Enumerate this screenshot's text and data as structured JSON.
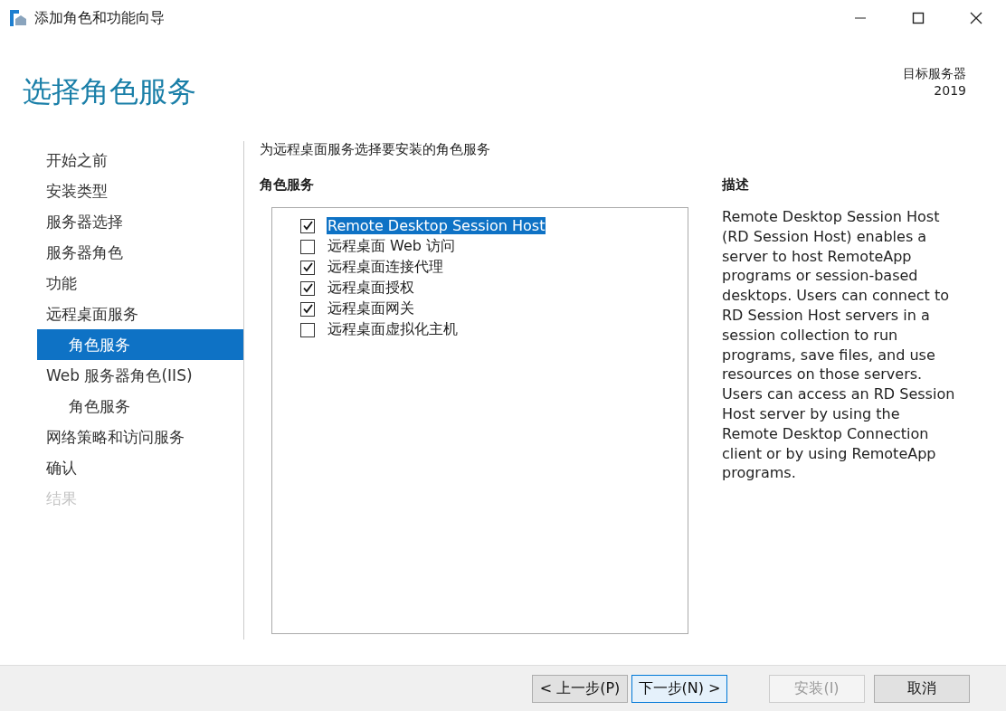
{
  "window": {
    "title": "添加角色和功能向导"
  },
  "header": {
    "title": "选择角色服务",
    "target_label": "目标服务器",
    "target_value": "2019"
  },
  "sidebar": {
    "items": [
      {
        "label": "开始之前",
        "selected": false,
        "disabled": false
      },
      {
        "label": "安装类型",
        "selected": false,
        "disabled": false
      },
      {
        "label": "服务器选择",
        "selected": false,
        "disabled": false
      },
      {
        "label": "服务器角色",
        "selected": false,
        "disabled": false
      },
      {
        "label": "功能",
        "selected": false,
        "disabled": false
      },
      {
        "label": "远程桌面服务",
        "selected": false,
        "disabled": false,
        "children": [
          {
            "label": "角色服务",
            "selected": true,
            "disabled": false
          }
        ]
      },
      {
        "label": "Web 服务器角色(IIS)",
        "selected": false,
        "disabled": false,
        "children": [
          {
            "label": "角色服务",
            "selected": false,
            "disabled": false
          }
        ]
      },
      {
        "label": "网络策略和访问服务",
        "selected": false,
        "disabled": false
      },
      {
        "label": "确认",
        "selected": false,
        "disabled": false
      },
      {
        "label": "结果",
        "selected": false,
        "disabled": true
      }
    ]
  },
  "instruction": "为远程桌面服务选择要安装的角色服务",
  "role_services": {
    "heading": "角色服务",
    "items": [
      {
        "label": "Remote Desktop Session Host",
        "checked": true,
        "selected": true
      },
      {
        "label": "远程桌面 Web 访问",
        "checked": false,
        "selected": false
      },
      {
        "label": "远程桌面连接代理",
        "checked": true,
        "selected": false
      },
      {
        "label": "远程桌面授权",
        "checked": true,
        "selected": false
      },
      {
        "label": "远程桌面网关",
        "checked": true,
        "selected": false
      },
      {
        "label": "远程桌面虚拟化主机",
        "checked": false,
        "selected": false
      }
    ]
  },
  "description": {
    "heading": "描述",
    "text": "Remote Desktop Session Host (RD Session Host) enables a server to host RemoteApp programs or session-based desktops. Users can connect to RD Session Host servers in a session collection to run programs, save files, and use resources on those servers. Users can access an RD Session Host server by using the Remote Desktop Connection client or by using RemoteApp programs."
  },
  "buttons": [
    {
      "label": "< 上一步(P)",
      "disabled": false,
      "default": false
    },
    {
      "label": "下一步(N) >",
      "disabled": false,
      "default": true
    },
    {
      "label": "安装(I)",
      "disabled": true,
      "default": false
    },
    {
      "label": "取消",
      "disabled": false,
      "default": false
    }
  ]
}
